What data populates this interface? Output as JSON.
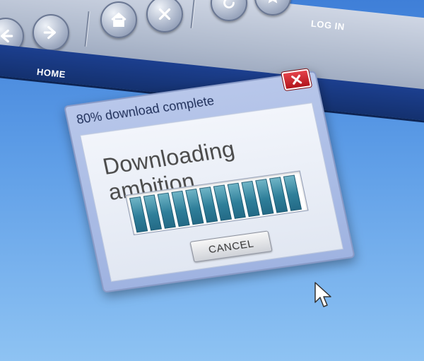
{
  "browser": {
    "toolbar": {
      "buttons": [
        {
          "name": "back-button",
          "icon": "arrow-left-icon"
        },
        {
          "name": "forward-button",
          "icon": "arrow-right-icon"
        },
        {
          "name": "home-button",
          "icon": "house-icon"
        },
        {
          "name": "stop-button",
          "icon": "x-icon"
        },
        {
          "name": "refresh-button",
          "icon": "refresh-icon"
        },
        {
          "name": "favorite-button",
          "icon": "star-icon"
        }
      ],
      "login_label": "LOG IN"
    },
    "nav": {
      "home_label": "HOME"
    }
  },
  "dialog": {
    "title": "80% download complete",
    "close_label": "X",
    "message": "Downloading ambition...",
    "progress_percent": 80,
    "cancel_label": "CANCEL"
  },
  "colors": {
    "background": "#5b9be6",
    "navbar": "#14316f",
    "progress_fill": "#2f7f9a",
    "close_button": "#c81f27"
  }
}
